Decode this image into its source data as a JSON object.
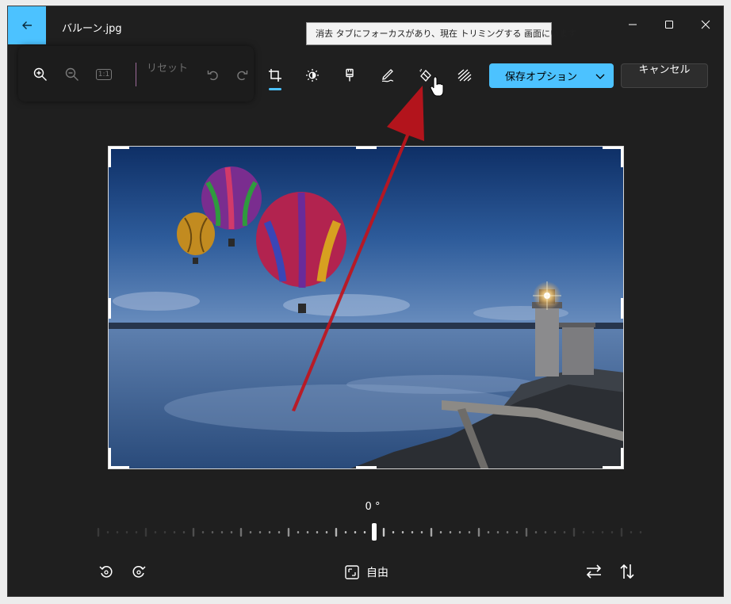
{
  "window": {
    "title": "バルーン.jpg"
  },
  "tooltip": {
    "text": "消去 タブにフォーカスがあり、現在 トリミングする 画面にいます"
  },
  "toolbar": {
    "zoom_in": "zoom-in-icon",
    "zoom_out": "zoom-out-icon",
    "actual_size_label": "1:1",
    "reset_label": "リセット",
    "undo": "undo-icon",
    "redo": "redo-icon",
    "tools": [
      "crop-icon",
      "adjust-brightness-icon",
      "filter-icon",
      "markup-pen-icon",
      "erase-icon",
      "background-blur-icon"
    ],
    "active_tool": "crop-icon",
    "save_label": "保存オプション",
    "cancel_label": "キャンセル"
  },
  "rotation": {
    "angle_label": "0 °",
    "angle_value": 0
  },
  "aspect": {
    "label": "自由"
  },
  "colors": {
    "accent": "#4cc2ff",
    "background": "#1f1f1f",
    "annotation_arrow": "#c0141c"
  }
}
